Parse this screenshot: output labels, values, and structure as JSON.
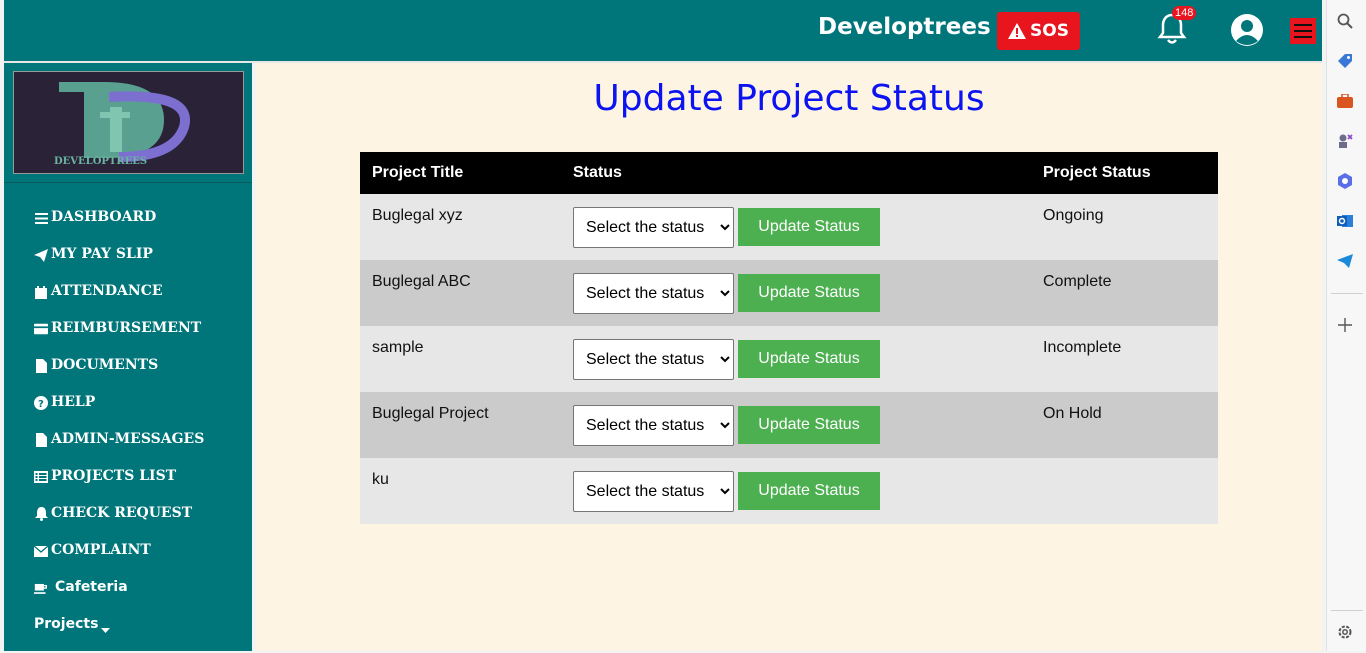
{
  "header": {
    "brand": "Developtrees",
    "sos_label": "SOS",
    "notification_count": "148"
  },
  "sidebar": {
    "logo_text": "DEVELOPTREES",
    "items": [
      {
        "label": "DASHBOARD",
        "icon": "bars-icon"
      },
      {
        "label": "MY PAY SLIP",
        "icon": "paper-plane-icon"
      },
      {
        "label": "ATTENDANCE",
        "icon": "calendar-icon"
      },
      {
        "label": "REIMBURSEMENT",
        "icon": "credit-card-icon"
      },
      {
        "label": "DOCUMENTS",
        "icon": "file-icon"
      },
      {
        "label": "HELP",
        "icon": "question-circle-icon"
      },
      {
        "label": "ADMIN-MESSAGES",
        "icon": "file-icon"
      },
      {
        "label": "PROJECTS LIST",
        "icon": "list-icon"
      },
      {
        "label": "CHECK REQUEST",
        "icon": "bell-icon"
      },
      {
        "label": "COMPLAINT",
        "icon": "envelope-icon"
      },
      {
        "label": "Cafeteria",
        "icon": "coffee-icon"
      },
      {
        "label": "Projects",
        "icon": "caret-down-icon"
      }
    ]
  },
  "main": {
    "title": "Update Project Status",
    "columns": [
      "Project Title",
      "Status",
      "Project Status"
    ],
    "select_default": "Select the status",
    "button_label": "Update Status",
    "rows": [
      {
        "title": "Buglegal xyz",
        "status": "Ongoing"
      },
      {
        "title": "Buglegal ABC",
        "status": "Complete"
      },
      {
        "title": "sample",
        "status": "Incomplete"
      },
      {
        "title": "Buglegal Project",
        "status": "On Hold"
      },
      {
        "title": "ku",
        "status": ""
      }
    ]
  },
  "colors": {
    "teal": "#01767a",
    "sos_red": "#e8141e",
    "title_blue": "#0b14f0",
    "button_green": "#4caf50",
    "page_bg": "#fdf4e4"
  }
}
